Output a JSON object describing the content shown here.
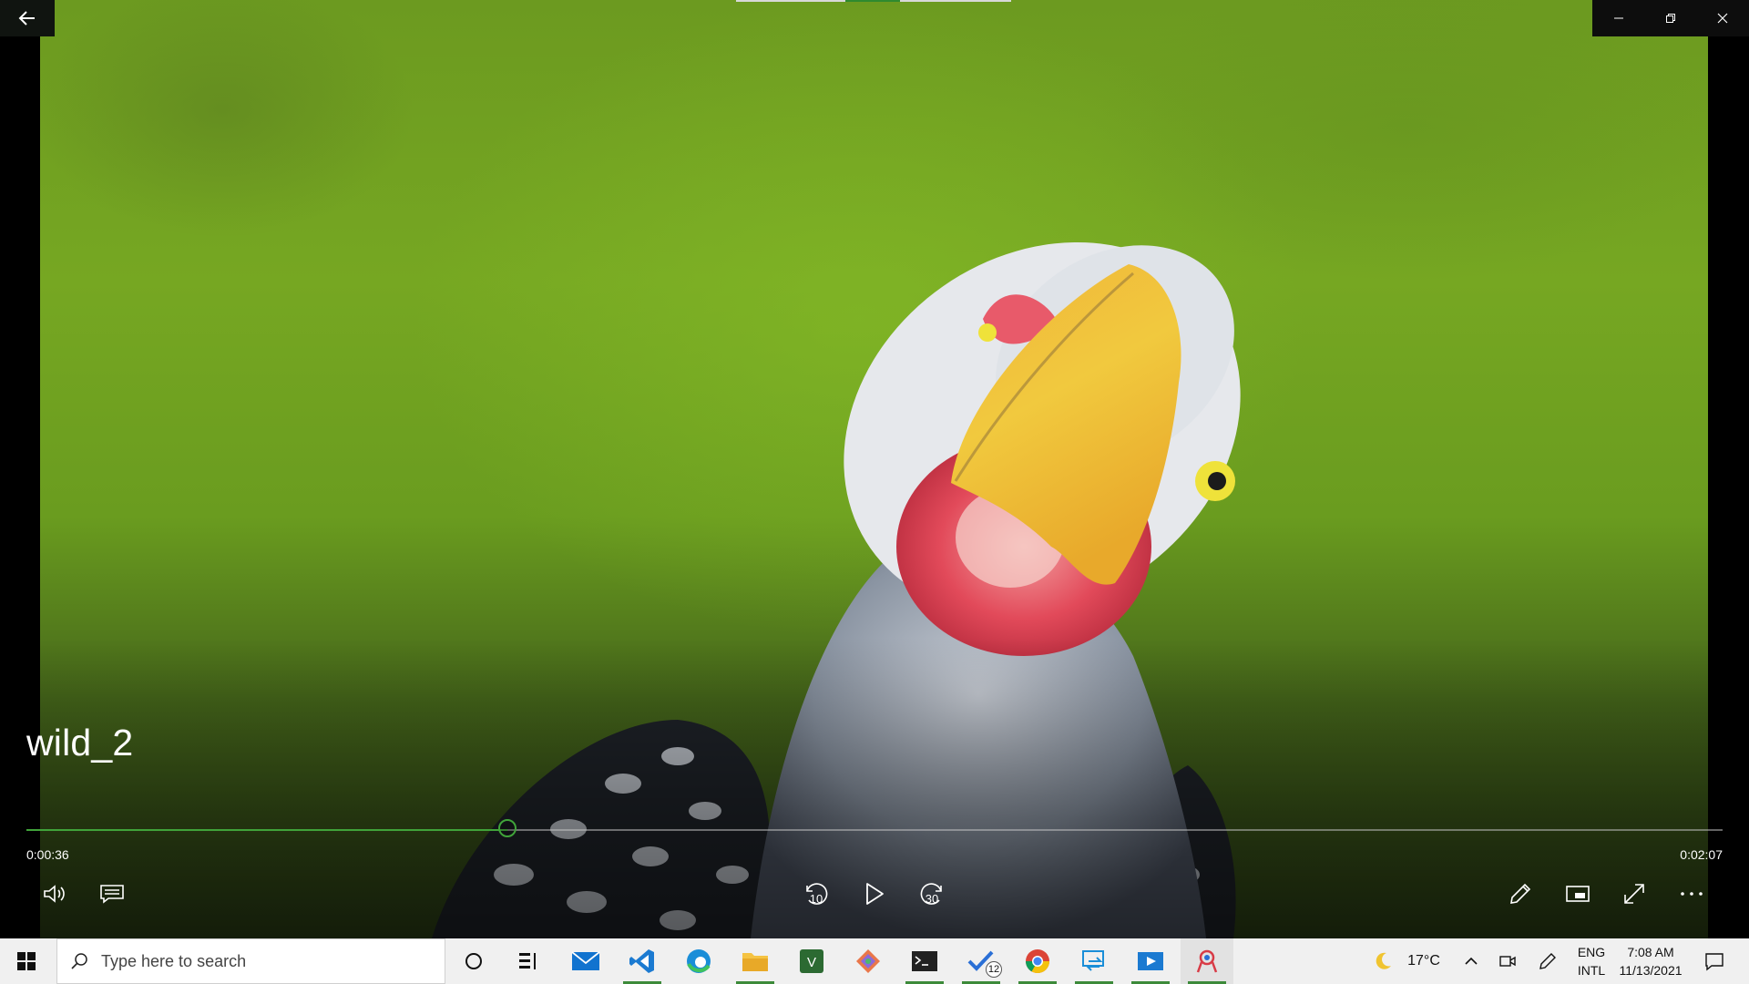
{
  "video": {
    "title": "wild_2",
    "current_time": "0:00:36",
    "total_time": "0:02:07",
    "progress_fraction": 0.2835
  },
  "controls": {
    "left": [
      "volume-icon",
      "subtitles-icon"
    ],
    "center": [
      "skip-back-icon",
      "play-icon",
      "skip-forward-icon"
    ],
    "skip_back_label": "10",
    "skip_forward_label": "30",
    "right": [
      "edit-pen-icon",
      "mini-view-icon",
      "fullscreen-icon",
      "more-icon"
    ]
  },
  "taskbar": {
    "search_placeholder": "Type here to search",
    "weather_temp": "17°C",
    "lang_top": "ENG",
    "lang_bottom": "INTL",
    "time": "7:08 AM",
    "date": "11/13/2021",
    "todo_badge": "12"
  },
  "colors": {
    "accent": "#40a33a",
    "taskbar_bg": "#f0f0f0"
  }
}
